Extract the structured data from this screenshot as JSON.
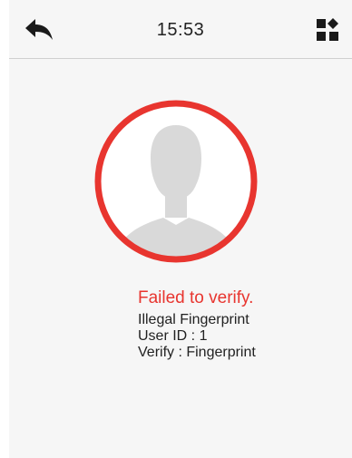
{
  "header": {
    "time": "15:53",
    "back_icon": "back-arrow-icon",
    "menu_icon": "grid-menu-icon"
  },
  "avatar": {
    "icon": "user-silhouette-icon",
    "ring_color": "#e8352f"
  },
  "result": {
    "title": "Failed to verify.",
    "reason": "Illegal Fingerprint",
    "user_id": "User ID : 1",
    "verify_mode": "Verify : Fingerprint"
  },
  "colors": {
    "error": "#e8352f",
    "background": "#f6f6f6",
    "text": "#222222"
  }
}
